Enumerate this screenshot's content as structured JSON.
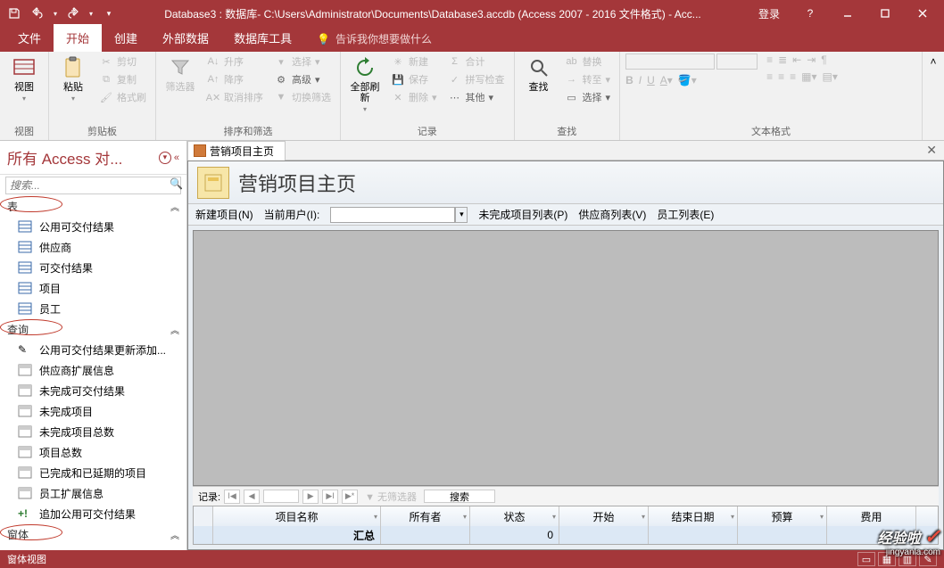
{
  "titlebar": {
    "title": "Database3 : 数据库- C:\\Users\\Administrator\\Documents\\Database3.accdb (Access 2007 - 2016 文件格式) - Acc...",
    "login": "登录"
  },
  "tabs": {
    "file": "文件",
    "home": "开始",
    "create": "创建",
    "external": "外部数据",
    "dbtools": "数据库工具",
    "tell": "告诉我你想要做什么"
  },
  "ribbon": {
    "view": {
      "label": "视图",
      "group": "视图"
    },
    "clipboard": {
      "paste": "粘贴",
      "cut": "剪切",
      "copy": "复制",
      "fmtpainter": "格式刷",
      "group": "剪贴板"
    },
    "sortfilter": {
      "filter": "筛选器",
      "asc": "升序",
      "desc": "降序",
      "clear": "取消排序",
      "sel": "选择",
      "adv": "高级",
      "toggle": "切换筛选",
      "group": "排序和筛选"
    },
    "records": {
      "refresh": "全部刷新",
      "new": "新建",
      "save": "保存",
      "delete": "删除",
      "totals": "合计",
      "spell": "拼写检查",
      "more": "其他",
      "group": "记录"
    },
    "find": {
      "find": "查找",
      "replace": "替换",
      "goto": "转至",
      "select": "选择",
      "group": "查找"
    },
    "textfmt": {
      "group": "文本格式"
    }
  },
  "nav": {
    "header": "所有 Access 对...",
    "search_ph": "搜索...",
    "groups": {
      "tables": {
        "label": "表",
        "items": [
          "公用可交付结果",
          "供应商",
          "可交付结果",
          "项目",
          "员工"
        ]
      },
      "queries": {
        "label": "查询",
        "items": [
          "公用可交付结果更新添加...",
          "供应商扩展信息",
          "未完成可交付结果",
          "未完成项目",
          "未完成项目总数",
          "项目总数",
          "已完成和已延期的项目",
          "员工扩展信息",
          "追加公用可交付结果"
        ]
      },
      "forms": {
        "label": "窗体"
      }
    }
  },
  "doc": {
    "tab": "营销项目主页",
    "title": "营销项目主页",
    "toolbar": {
      "newproj": "新建项目(N)",
      "curuser": "当前用户(I):",
      "unfinished": "未完成项目列表(P)",
      "vendors": "供应商列表(V)",
      "staff": "员工列表(E)"
    },
    "recnav": {
      "label": "记录:",
      "pos": "",
      "filter": "无筛选器",
      "search": "搜索"
    },
    "columns": [
      "项目名称",
      "所有者",
      "状态",
      "开始",
      "结束日期",
      "预算",
      "费用"
    ],
    "summary": {
      "label": "汇总",
      "status": "0"
    }
  },
  "status": {
    "left": "窗体视图"
  },
  "watermark": {
    "brand": "经验啦",
    "url": "jingyanla.com"
  }
}
